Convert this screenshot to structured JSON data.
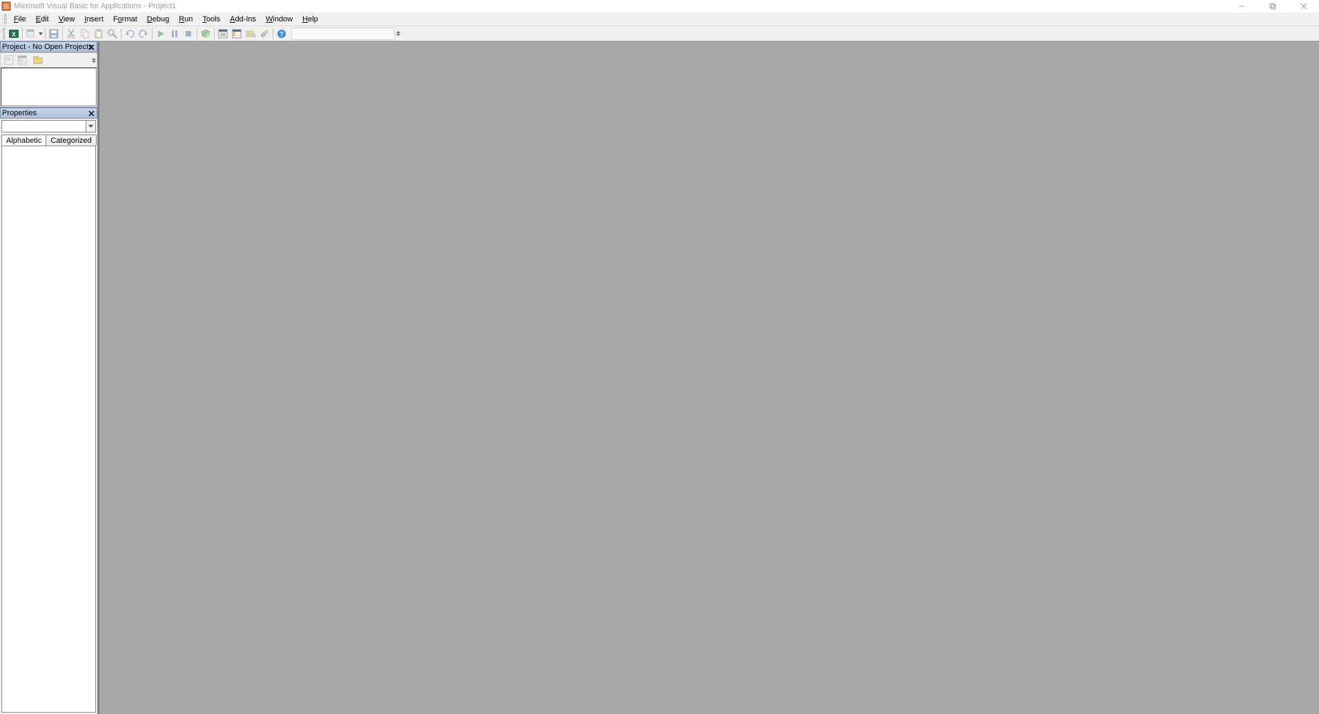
{
  "titlebar": {
    "title": "Microsoft Visual Basic for Applications - Project1"
  },
  "menubar": {
    "items": [
      {
        "label": "File",
        "accel": "F"
      },
      {
        "label": "Edit",
        "accel": "E"
      },
      {
        "label": "View",
        "accel": "V"
      },
      {
        "label": "Insert",
        "accel": "I"
      },
      {
        "label": "Format",
        "accel": "o"
      },
      {
        "label": "Debug",
        "accel": "D"
      },
      {
        "label": "Run",
        "accel": "R"
      },
      {
        "label": "Tools",
        "accel": "T"
      },
      {
        "label": "Add-Ins",
        "accel": "A"
      },
      {
        "label": "Window",
        "accel": "W"
      },
      {
        "label": "Help",
        "accel": "H"
      }
    ]
  },
  "toolbar": {
    "position_text": ""
  },
  "project_pane": {
    "title": "Project - No Open Projects"
  },
  "properties_pane": {
    "title": "Properties",
    "object_selected": "",
    "tabs": {
      "alphabetic": "Alphabetic",
      "categorized": "Categorized"
    }
  }
}
